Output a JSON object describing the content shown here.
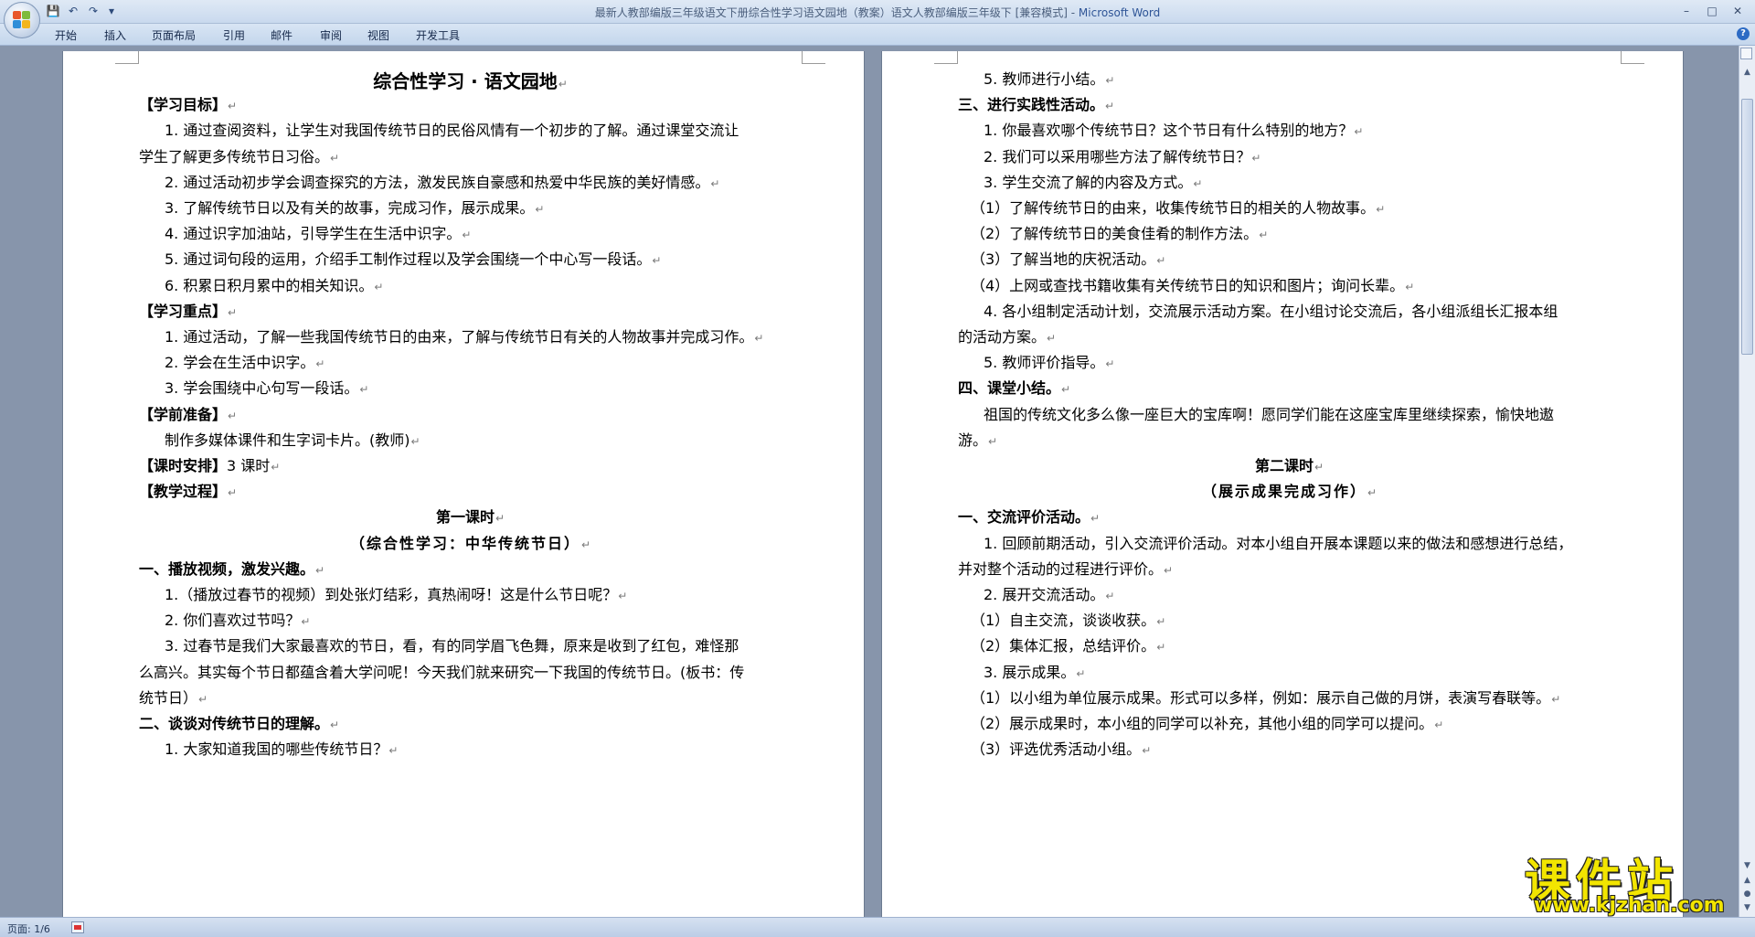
{
  "window": {
    "title": "最新人教部编版三年级语文下册综合性学习语文园地（教案）语文人教部编版三年级下 [兼容模式] - ",
    "app_name": "Microsoft Word",
    "controls": {
      "minimize": "–",
      "maximize": "□",
      "close": "✕"
    }
  },
  "quick_access": {
    "save": "💾",
    "undo": "↶",
    "redo": "↷",
    "more": "▾"
  },
  "ribbon": {
    "tabs": [
      "开始",
      "插入",
      "页面布局",
      "引用",
      "邮件",
      "审阅",
      "视图",
      "开发工具"
    ],
    "help": "?"
  },
  "pilcrow": "↵",
  "page_left": {
    "lines": [
      {
        "text": "综合性学习 · 语文园地",
        "style": "t-title",
        "center": true
      },
      {
        "text": "【学习目标】",
        "style": "b"
      },
      {
        "text": "1. 通过查阅资料，让学生对我国传统节日的民俗风情有一个初步的了解。通过课堂交流让",
        "indent": 1,
        "nop": true
      },
      {
        "text": "学生了解更多传统节日习俗。"
      },
      {
        "text": "2. 通过活动初步学会调查探究的方法，激发民族自豪感和热爱中华民族的美好情感。",
        "indent": 1
      },
      {
        "text": "3. 了解传统节日以及有关的故事，完成习作，展示成果。",
        "indent": 1
      },
      {
        "text": "4. 通过识字加油站，引导学生在生活中识字。",
        "indent": 1
      },
      {
        "text": "5. 通过词句段的运用，介绍手工制作过程以及学会围绕一个中心写一段话。",
        "indent": 1
      },
      {
        "text": "6. 积累日积月累中的相关知识。",
        "indent": 1
      },
      {
        "text": "【学习重点】",
        "style": "b"
      },
      {
        "text": "1. 通过活动，了解一些我国传统节日的由来，了解与传统节日有关的人物故事并完成习作。",
        "indent": 1
      },
      {
        "text": "2. 学会在生活中识字。",
        "indent": 1
      },
      {
        "text": "3. 学会围绕中心句写一段话。",
        "indent": 1
      },
      {
        "text": "【学前准备】",
        "style": "b"
      },
      {
        "text": "制作多媒体课件和生字词卡片。(教师)",
        "indent": 1
      },
      {
        "text": "【课时安排】3 课时",
        "style": "mixed",
        "bold_part": "【课时安排】",
        "rest": "3 课时"
      },
      {
        "text": "【教学过程】",
        "style": "b"
      },
      {
        "text": "第一课时",
        "style": "b",
        "center": true
      },
      {
        "text": "（综合性学习：中华传统节日）",
        "style": "sub",
        "center": true
      },
      {
        "text": "一、播放视频，激发兴趣。",
        "style": "b"
      },
      {
        "text": "1.（播放过春节的视频）到处张灯结彩，真热闹呀！这是什么节日呢？",
        "indent": 1
      },
      {
        "text": "2. 你们喜欢过节吗？",
        "indent": 1
      },
      {
        "text": "3. 过春节是我们大家最喜欢的节日，看，有的同学眉飞色舞，原来是收到了红包，难怪那",
        "indent": 1,
        "nop": true
      },
      {
        "text": "么高兴。其实每个节日都蕴含着大学问呢！今天我们就来研究一下我国的传统节日。(板书：传",
        "nop": true
      },
      {
        "text": "统节日）"
      },
      {
        "text": "二、谈谈对传统节日的理解。",
        "style": "b"
      },
      {
        "text": "1. 大家知道我国的哪些传统节日？",
        "indent": 1
      }
    ]
  },
  "page_right": {
    "lines": [
      {
        "text": "5. 教师进行小结。",
        "indent": 1
      },
      {
        "text": "三、进行实践性活动。",
        "style": "b"
      },
      {
        "text": "1. 你最喜欢哪个传统节日？这个节日有什么特别的地方？",
        "indent": 1
      },
      {
        "text": "2. 我们可以采用哪些方法了解传统节日？",
        "indent": 1
      },
      {
        "text": "3. 学生交流了解的内容及方式。",
        "indent": 1
      },
      {
        "text": "（1）了解传统节日的由来，收集传统节日的相关的人物故事。",
        "indent": 0.5
      },
      {
        "text": "（2）了解传统节日的美食佳肴的制作方法。",
        "indent": 0.5
      },
      {
        "text": "（3）了解当地的庆祝活动。",
        "indent": 0.5
      },
      {
        "text": "（4）上网或查找书籍收集有关传统节日的知识和图片；询问长辈。",
        "indent": 0.5
      },
      {
        "text": "4. 各小组制定活动计划，交流展示活动方案。在小组讨论交流后，各小组派组长汇报本组",
        "indent": 1,
        "nop": true
      },
      {
        "text": "的活动方案。"
      },
      {
        "text": "5. 教师评价指导。",
        "indent": 1
      },
      {
        "text": "四、课堂小结。",
        "style": "b"
      },
      {
        "text": "祖国的传统文化多么像一座巨大的宝库啊！愿同学们能在这座宝库里继续探索，愉快地遨",
        "indent": 1,
        "nop": true
      },
      {
        "text": "游。"
      },
      {
        "text": "第二课时",
        "style": "b",
        "center": true
      },
      {
        "text": "（展示成果完成习作）",
        "style": "sub",
        "center": true
      },
      {
        "text": "一、交流评价活动。",
        "style": "b"
      },
      {
        "text": "1. 回顾前期活动，引入交流评价活动。对本小组自开展本课题以来的做法和感想进行总结，",
        "indent": 1,
        "nop": true
      },
      {
        "text": "并对整个活动的过程进行评价。"
      },
      {
        "text": "2. 展开交流活动。",
        "indent": 1
      },
      {
        "text": "（1）自主交流，谈谈收获。",
        "indent": 0.5
      },
      {
        "text": "（2）集体汇报，总结评价。",
        "indent": 0.5
      },
      {
        "text": "3. 展示成果。",
        "indent": 1
      },
      {
        "text": "（1）以小组为单位展示成果。形式可以多样，例如：展示自己做的月饼，表演写春联等。",
        "indent": 0.5
      },
      {
        "text": "（2）展示成果时，本小组的同学可以补充，其他小组的同学可以提问。",
        "indent": 0.5
      },
      {
        "text": "（3）评选优秀活动小组。",
        "indent": 0.5
      }
    ]
  },
  "status": {
    "page": "页面: 1/6"
  },
  "watermark": {
    "big": "课件站",
    "small": "www.kjzhan.com"
  },
  "colors": {
    "ribbon_bg": "#c9d9ee",
    "doc_bg": "#8795ab",
    "watermark": "#f2e500"
  }
}
